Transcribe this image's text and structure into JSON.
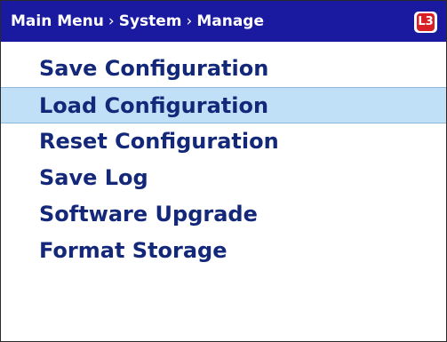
{
  "header": {
    "breadcrumb": [
      "Main Menu",
      "System",
      "Manage"
    ],
    "separator": "›",
    "logo_text": "L3",
    "background_color": "#1a1aa0"
  },
  "menu": {
    "items": [
      {
        "label": "Save Configuration",
        "selected": false
      },
      {
        "label": "Load Configuration",
        "selected": true
      },
      {
        "label": "Reset Configuration",
        "selected": false
      },
      {
        "label": "Save Log",
        "selected": false
      },
      {
        "label": "Software Upgrade",
        "selected": false
      },
      {
        "label": "Format Storage",
        "selected": false
      }
    ],
    "text_color": "#14287a",
    "selected_background": "#bfe0f7"
  }
}
